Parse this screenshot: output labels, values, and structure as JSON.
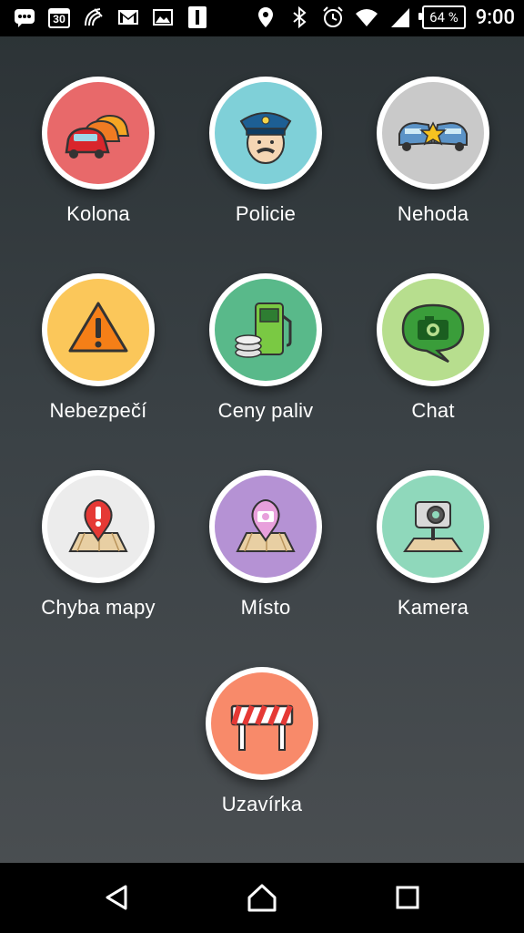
{
  "status_bar": {
    "date_badge": "30",
    "battery_percent": "64 %",
    "time": "9:00",
    "icons_left": [
      "messages-icon",
      "calendar-icon",
      "nfc-icon",
      "gmail-icon",
      "photo-icon",
      "app-icon"
    ],
    "icons_right": [
      "location-icon",
      "bluetooth-icon",
      "alarm-icon",
      "wifi-icon",
      "signal-icon",
      "battery-icon"
    ]
  },
  "report_options": [
    {
      "label": "Kolona",
      "icon": "traffic-jam-icon",
      "color": "#e8696a"
    },
    {
      "label": "Policie",
      "icon": "police-icon",
      "color": "#7fd0d8"
    },
    {
      "label": "Nehoda",
      "icon": "accident-icon",
      "color": "#c9c9c9"
    },
    {
      "label": "Nebezpečí",
      "icon": "hazard-icon",
      "color": "#fbc75a"
    },
    {
      "label": "Ceny paliv",
      "icon": "fuel-price-icon",
      "color": "#59b98a"
    },
    {
      "label": "Chat",
      "icon": "chat-camera-icon",
      "color": "#b7de8e"
    },
    {
      "label": "Chyba mapy",
      "icon": "map-error-icon",
      "color": "#ececec"
    },
    {
      "label": "Místo",
      "icon": "place-icon",
      "color": "#b592d4"
    },
    {
      "label": "Kamera",
      "icon": "speed-camera-icon",
      "color": "#8fd8bb"
    },
    {
      "label": "Uzavírka",
      "icon": "road-closure-icon",
      "color": "#f88a6a"
    }
  ],
  "nav_bar": {
    "buttons": [
      "back-icon",
      "home-icon",
      "recents-icon"
    ]
  }
}
